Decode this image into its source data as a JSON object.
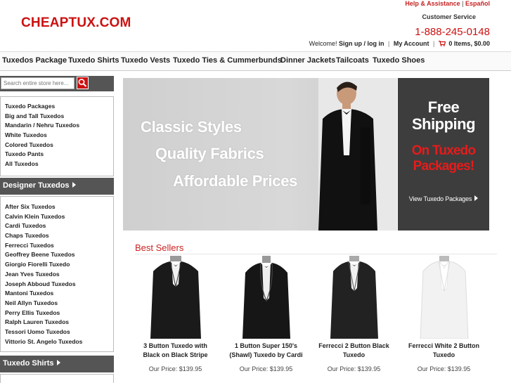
{
  "header": {
    "logo": "CHEAPTUX.COM",
    "help_link": "Help & Assistance",
    "lang_link": "Español",
    "customer_service": "Customer Service",
    "phone": "1-888-245-0148",
    "welcome": "Welcome!",
    "signup": "Sign up / log in",
    "my_account": "My Account",
    "cart": "0 Items,",
    "cart_total": "$0.00"
  },
  "nav": {
    "items": [
      "Tuxedos Package",
      "Tuxedo Shirts",
      "Tuxedo Vests",
      "Tuxedo Ties & Cummerbunds",
      "Dinner Jackets",
      "Tailcoats",
      "Tuxedo Shoes"
    ]
  },
  "search": {
    "placeholder": "Search entire store here..."
  },
  "sidebar": {
    "tuxedo_links": [
      "Tuxedo Packages",
      "Big and Tall Tuxedos",
      "Mandarin / Nehru Tuxedos",
      "White Tuxedos",
      "Colored Tuxedos",
      "Tuxedo Pants",
      "All Tuxedos"
    ],
    "designer_header": "Designer Tuxedos",
    "designer_links": [
      "After Six Tuxedos",
      "Calvin Klein Tuxedos",
      "Cardi Tuxedos",
      "Chaps Tuxedos",
      "Ferrecci Tuxedos",
      "Geoffrey Beene Tuxedos",
      "Giorgio Fiorelli Tuxedo",
      "Jean Yves Tuxedos",
      "Joseph Abboud Tuxedos",
      "Mantoni Tuxedos",
      "Neil Allyn Tuxedos",
      "Perry Ellis Tuxedos",
      "Ralph Lauren Tuxedos",
      "Tessori Uomo Tuxedos",
      "Vittorio St. Angelo Tuxedos"
    ],
    "shirts_header": "Tuxedo Shirts"
  },
  "hero": {
    "line1": "Classic Styles",
    "line2": "Quality Fabrics",
    "line3": "Affordable Prices"
  },
  "promo": {
    "line1": "Free",
    "line2": "Shipping",
    "red1": "On Tuxedo",
    "red2": "Packages!",
    "link": "View Tuxedo Packages"
  },
  "best_sellers": {
    "title": "Best Sellers",
    "products": [
      {
        "name": "3 Button Tuxedo with Black on Black Stripe",
        "price": "Our Price: $139.95",
        "color": "#1a1a1a"
      },
      {
        "name": "1 Button Super 150's (Shawl) Tuxedo by Cardi",
        "price": "Our Price: $139.95",
        "color": "#1a1a1a"
      },
      {
        "name": "Ferrecci 2 Button Black Tuxedo",
        "price": "Our Price: $139.95",
        "color": "#222222"
      },
      {
        "name": "Ferrecci White 2 Button Tuxedo",
        "price": "Our Price: $139.95",
        "color": "#f2f2f2"
      }
    ]
  },
  "colors": {
    "brand_red": "#cc1111",
    "sidebar_dark": "#555555",
    "promo_bg": "#3d3d3d"
  }
}
